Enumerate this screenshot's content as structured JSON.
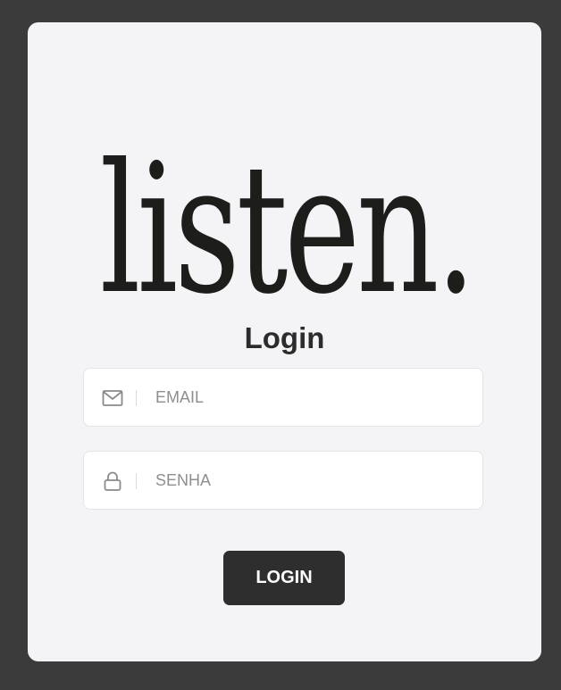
{
  "brand": {
    "logo_text": "listen."
  },
  "form": {
    "title": "Login",
    "email": {
      "placeholder": "EMAIL",
      "value": "",
      "icon": "envelope-icon"
    },
    "password": {
      "placeholder": "SENHA",
      "value": "",
      "icon": "lock-icon"
    },
    "submit_label": "LOGIN"
  },
  "colors": {
    "background": "#3b3b3b",
    "card": "#f4f4f6",
    "button": "#2e2e2f",
    "text_dark": "#1d1d1b"
  }
}
